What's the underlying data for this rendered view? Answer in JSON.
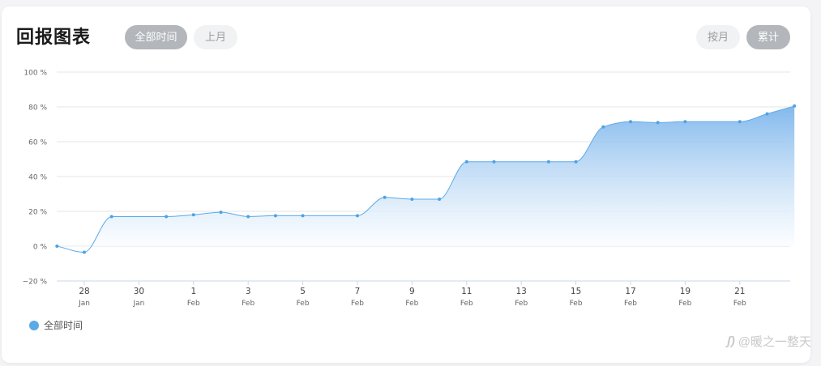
{
  "header": {
    "title": "回报图表",
    "range_tabs": [
      {
        "label": "全部时间",
        "active": true
      },
      {
        "label": "上月",
        "active": false
      }
    ],
    "mode_tabs": [
      {
        "label": "按月",
        "active": false
      },
      {
        "label": "累计",
        "active": true
      }
    ]
  },
  "legend": {
    "label": "全部时间"
  },
  "watermark": {
    "text": "@暖之一整天",
    "icon": "zhihu-logo-icon"
  },
  "colors": {
    "line": "#5aaae6",
    "point": "#4da3e4",
    "fill_top": "#7cb5ec",
    "fill_bottom": "#ffffff",
    "grid": "#e6e6e6",
    "axis_text": "#666666",
    "legend_dot": "#5aaae6"
  },
  "chart_data": {
    "type": "area",
    "title": "",
    "xlabel": "",
    "ylabel": "",
    "ylim": [
      -20,
      100
    ],
    "y_ticks": [
      {
        "value": 100,
        "label": "100 %"
      },
      {
        "value": 80,
        "label": "80 %"
      },
      {
        "value": 60,
        "label": "60 %"
      },
      {
        "value": 40,
        "label": "40 %"
      },
      {
        "value": 20,
        "label": "20 %"
      },
      {
        "value": 0,
        "label": "0 %"
      },
      {
        "value": -20,
        "label": "−20 %"
      }
    ],
    "x_ticks": [
      {
        "date": "Jan 28",
        "day": "28",
        "month": "Jan"
      },
      {
        "date": "Jan 30",
        "day": "30",
        "month": "Jan"
      },
      {
        "date": "Feb 1",
        "day": "1",
        "month": "Feb"
      },
      {
        "date": "Feb 3",
        "day": "3",
        "month": "Feb"
      },
      {
        "date": "Feb 5",
        "day": "5",
        "month": "Feb"
      },
      {
        "date": "Feb 7",
        "day": "7",
        "month": "Feb"
      },
      {
        "date": "Feb 9",
        "day": "9",
        "month": "Feb"
      },
      {
        "date": "Feb 11",
        "day": "11",
        "month": "Feb"
      },
      {
        "date": "Feb 13",
        "day": "13",
        "month": "Feb"
      },
      {
        "date": "Feb 15",
        "day": "15",
        "month": "Feb"
      },
      {
        "date": "Feb 17",
        "day": "17",
        "month": "Feb"
      },
      {
        "date": "Feb 19",
        "day": "19",
        "month": "Feb"
      },
      {
        "date": "Feb 21",
        "day": "21",
        "month": "Feb"
      }
    ],
    "grid": true,
    "legend_position": "bottom-left",
    "series": [
      {
        "name": "全部时间",
        "points": [
          {
            "x": "Jan 27",
            "y": 0
          },
          {
            "x": "Jan 28",
            "y": -3.5
          },
          {
            "x": "Jan 29",
            "y": 17
          },
          {
            "x": "Jan 31",
            "y": 17
          },
          {
            "x": "Feb 1",
            "y": 18
          },
          {
            "x": "Feb 2",
            "y": 19.5
          },
          {
            "x": "Feb 3",
            "y": 17
          },
          {
            "x": "Feb 4",
            "y": 17.5
          },
          {
            "x": "Feb 5",
            "y": 17.5
          },
          {
            "x": "Feb 7",
            "y": 17.5
          },
          {
            "x": "Feb 8",
            "y": 28
          },
          {
            "x": "Feb 9",
            "y": 27
          },
          {
            "x": "Feb 10",
            "y": 27
          },
          {
            "x": "Feb 11",
            "y": 48.5
          },
          {
            "x": "Feb 12",
            "y": 48.5
          },
          {
            "x": "Feb 14",
            "y": 48.5
          },
          {
            "x": "Feb 15",
            "y": 48.5
          },
          {
            "x": "Feb 16",
            "y": 68.5
          },
          {
            "x": "Feb 17",
            "y": 71.5
          },
          {
            "x": "Feb 18",
            "y": 71
          },
          {
            "x": "Feb 19",
            "y": 71.5
          },
          {
            "x": "Feb 21",
            "y": 71.5
          },
          {
            "x": "Feb 22",
            "y": 76
          },
          {
            "x": "Feb 23",
            "y": 80.5
          }
        ]
      }
    ]
  }
}
